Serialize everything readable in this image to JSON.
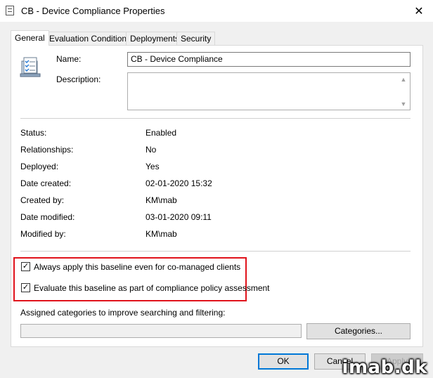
{
  "window": {
    "title": "CB - Device Compliance Properties"
  },
  "icons": {
    "app": "properties-doc-icon",
    "close": "close-icon",
    "baseline": "baseline-checklist-icon"
  },
  "tabs": [
    {
      "label": "General",
      "active": true
    },
    {
      "label": "Evaluation Conditions"
    },
    {
      "label": "Deployments"
    },
    {
      "label": "Security"
    }
  ],
  "general": {
    "name_label": "Name:",
    "name_value": "CB - Device Compliance",
    "description_label": "Description:",
    "description_value": ""
  },
  "properties": [
    {
      "label": "Status:",
      "value": "Enabled"
    },
    {
      "label": "Relationships:",
      "value": "No"
    },
    {
      "label": "Deployed:",
      "value": "Yes"
    },
    {
      "label": "Date created:",
      "value": "02-01-2020 15:32"
    },
    {
      "label": "Created by:",
      "value": "KM\\mab"
    },
    {
      "label": "Date modified:",
      "value": "03-01-2020 09:11"
    },
    {
      "label": "Modified by:",
      "value": "KM\\mab"
    }
  ],
  "options": {
    "always_apply": {
      "label": "Always apply this baseline even for co-managed clients",
      "checked": true
    },
    "evaluate_compliance": {
      "label": "Evaluate this baseline as part of compliance policy assessment",
      "checked": true
    }
  },
  "categories": {
    "label": "Assigned categories to improve searching and filtering:",
    "value": "",
    "button_label": "Categories..."
  },
  "buttons": {
    "ok": "OK",
    "cancel": "Cancel",
    "apply": "Apply"
  },
  "colors": {
    "highlight": "#e0121b",
    "default_button_border": "#0078d7"
  },
  "watermark": "imab.dk"
}
